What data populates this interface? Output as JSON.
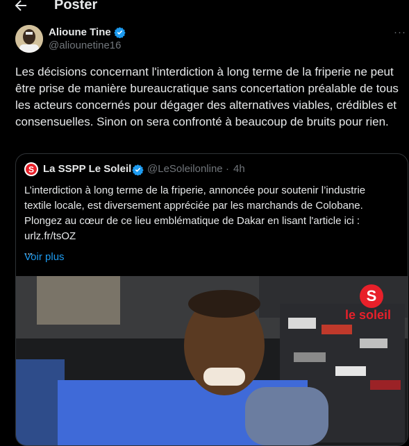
{
  "header": {
    "title": "Poster"
  },
  "tweet": {
    "author_name": "Alioune Tine",
    "handle": "@aliounetine16",
    "more_label": "···",
    "text": "Les décisions concernant l'interdiction à long terme de la friperie ne peut être prise de manière bureaucratique sans concertation préalable de tous les acteurs concernés pour dégager des alternatives viables, crédibles et consensuelles. Sinon on sera confronté à beaucoup de bruits pour rien."
  },
  "quote": {
    "author_name": "La SSPP Le Soleil",
    "handle": "@LeSoleilonline",
    "separator": "·",
    "time": "4h",
    "avatar_letter": "S",
    "lines": [
      "L’interdiction à long terme de la friperie, annoncée pour soutenir l’industrie",
      "textile locale, est diversement appréciée par les marchands de Colobane.",
      "Plongez au cœur de ce lieu emblématique de Dakar en lisant l'article ici :",
      "urlz.fr/tsOZ",
      "..."
    ],
    "see_more": "Voir plus",
    "media": {
      "logo_letter": "S",
      "logo_word": "le soleil"
    }
  },
  "colors": {
    "accent": "#1d9bf0",
    "brand_red": "#e8202a",
    "muted": "#71767b",
    "border": "#2f3336"
  },
  "icons": {
    "back": "arrow-left-icon",
    "verified": "verified-badge-icon",
    "more": "more-horizontal-icon"
  }
}
